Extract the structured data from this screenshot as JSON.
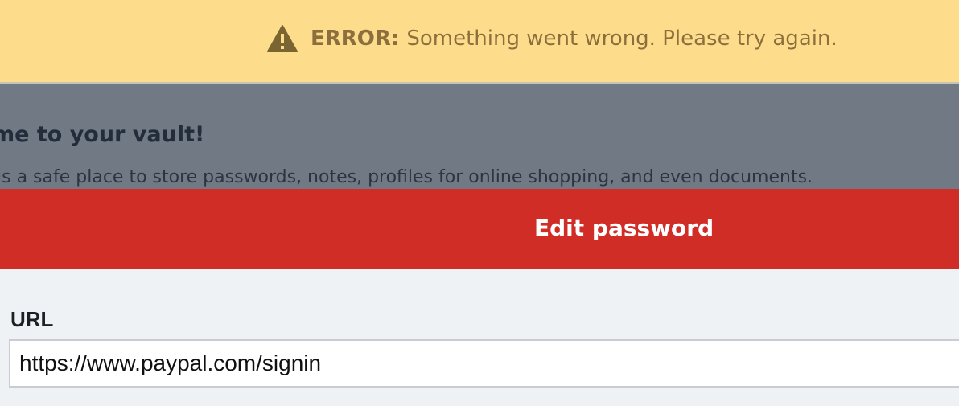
{
  "error_banner": {
    "icon": "warning-triangle-icon",
    "prefix": "ERROR:",
    "message": "Something went wrong. Please try again.",
    "bg_color": "#fddc8c",
    "text_color": "#8c6f3c"
  },
  "vault": {
    "title": "me to your vault!",
    "description": "is a safe place to store passwords, notes, profiles for online shopping, and even documents."
  },
  "modal": {
    "title": "Edit password",
    "header_color": "#d12d27",
    "fields": {
      "url": {
        "label": "URL",
        "value": "https://www.paypal.com/signin"
      }
    }
  }
}
